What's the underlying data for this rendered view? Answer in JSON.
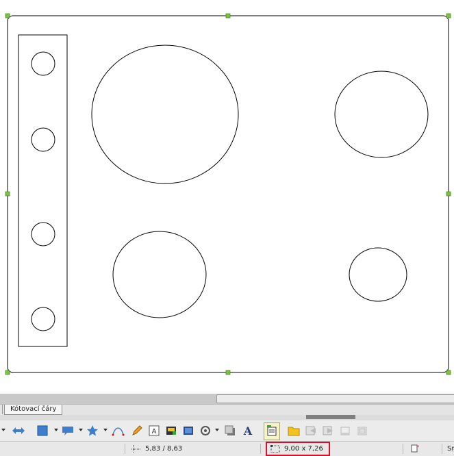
{
  "canvas": {
    "shapes": {
      "outer_rect": "rounded-rectangle",
      "control_panel": "rectangle",
      "knobs": 4,
      "burners": 4
    },
    "handle_color": "#7bc142",
    "stroke_color": "#000000"
  },
  "tabs": {
    "items": [
      {
        "label": "Kótovací čáry",
        "active": true
      }
    ]
  },
  "toolbar": {
    "icons": [
      "select-arrow-icon",
      "double-arrow-icon",
      "rectangle-shapes-icon",
      "callout-icon",
      "star-icon",
      "curve-icon",
      "pencil-icon",
      "text-frame-icon",
      "insert-image-icon",
      "insert-picture-icon",
      "rotate-icon",
      "shadow-icon",
      "fontwork-icon",
      "gluepoints-icon",
      "folder-icon",
      "toggle-extrusion-icon",
      "group-icon",
      "position-icon",
      "align-icon"
    ],
    "accent": "#3e7fcd"
  },
  "status": {
    "position": "5,83 / 8,63",
    "size": "9,00 x 7,26",
    "layout": "Sr",
    "highlight_color": "#d4102b"
  }
}
